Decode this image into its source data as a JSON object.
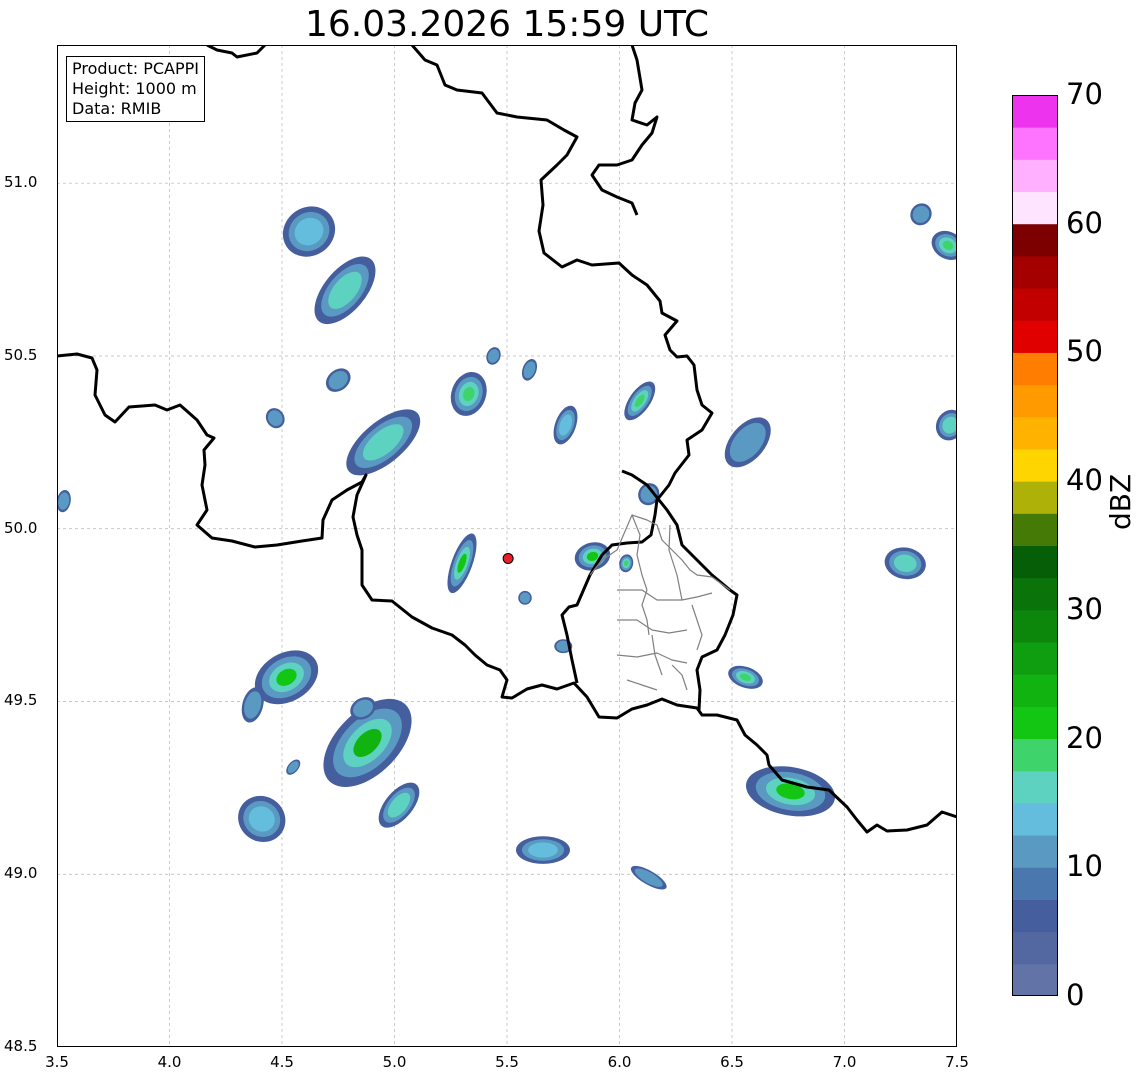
{
  "title": "16.03.2026 15:59 UTC",
  "info": {
    "product": "Product: PCAPPI",
    "height": "Height: 1000 m",
    "data": "Data: RMIB"
  },
  "map": {
    "lon_range": [
      3.5,
      7.5
    ],
    "lat_range": [
      48.5,
      51.4
    ],
    "grid": true,
    "x_ticks": [
      "3.5",
      "4.0",
      "4.5",
      "5.0",
      "5.5",
      "6.0",
      "6.5",
      "7.0",
      "7.5"
    ],
    "y_ticks": [
      "48.5",
      "49.0",
      "49.5",
      "50.0",
      "50.5",
      "51.0"
    ],
    "radar_site": {
      "lon": 5.505,
      "lat": 49.914,
      "color": "#e8202a"
    },
    "echoes": [
      {
        "lon": 4.62,
        "lat": 50.86,
        "rlon": 0.12,
        "rlat": 0.07,
        "angle": -35,
        "dbz": 14
      },
      {
        "lon": 4.78,
        "lat": 50.69,
        "rlon": 0.18,
        "rlat": 0.06,
        "angle": -50,
        "dbz": 16
      },
      {
        "lon": 4.95,
        "lat": 50.25,
        "rlon": 0.2,
        "rlat": 0.06,
        "angle": -40,
        "dbz": 16
      },
      {
        "lon": 4.75,
        "lat": 50.43,
        "rlon": 0.06,
        "rlat": 0.03,
        "angle": -40,
        "dbz": 10
      },
      {
        "lon": 4.47,
        "lat": 50.32,
        "rlon": 0.04,
        "rlat": 0.03,
        "angle": -30,
        "dbz": 10
      },
      {
        "lon": 5.33,
        "lat": 50.39,
        "rlon": 0.1,
        "rlat": 0.05,
        "angle": -70,
        "dbz": 18
      },
      {
        "lon": 5.44,
        "lat": 50.5,
        "rlon": 0.04,
        "rlat": 0.02,
        "angle": -70,
        "dbz": 10
      },
      {
        "lon": 5.6,
        "lat": 50.46,
        "rlon": 0.05,
        "rlat": 0.02,
        "angle": -70,
        "dbz": 10
      },
      {
        "lon": 5.76,
        "lat": 50.3,
        "rlon": 0.09,
        "rlat": 0.03,
        "angle": -70,
        "dbz": 14
      },
      {
        "lon": 6.09,
        "lat": 50.37,
        "rlon": 0.1,
        "rlat": 0.03,
        "angle": -55,
        "dbz": 18
      },
      {
        "lon": 6.13,
        "lat": 50.1,
        "rlon": 0.05,
        "rlat": 0.03,
        "angle": -60,
        "dbz": 10
      },
      {
        "lon": 6.57,
        "lat": 50.25,
        "rlon": 0.13,
        "rlat": 0.05,
        "angle": -50,
        "dbz": 12
      },
      {
        "lon": 5.3,
        "lat": 49.9,
        "rlon": 0.14,
        "rlat": 0.03,
        "angle": -70,
        "dbz": 20
      },
      {
        "lon": 5.88,
        "lat": 49.92,
        "rlon": 0.08,
        "rlat": 0.04,
        "angle": -15,
        "dbz": 20
      },
      {
        "lon": 6.03,
        "lat": 49.9,
        "rlon": 0.04,
        "rlat": 0.02,
        "angle": -80,
        "dbz": 18
      },
      {
        "lon": 5.58,
        "lat": 49.8,
        "rlon": 0.03,
        "rlat": 0.02,
        "angle": 0,
        "dbz": 10
      },
      {
        "lon": 5.75,
        "lat": 49.66,
        "rlon": 0.04,
        "rlat": 0.02,
        "angle": 0,
        "dbz": 10
      },
      {
        "lon": 4.52,
        "lat": 49.57,
        "rlon": 0.15,
        "rlat": 0.07,
        "angle": -30,
        "dbz": 22
      },
      {
        "lon": 4.37,
        "lat": 49.49,
        "rlon": 0.08,
        "rlat": 0.03,
        "angle": -75,
        "dbz": 12
      },
      {
        "lon": 4.88,
        "lat": 49.38,
        "rlon": 0.24,
        "rlat": 0.09,
        "angle": -45,
        "dbz": 24
      },
      {
        "lon": 5.02,
        "lat": 49.2,
        "rlon": 0.12,
        "rlat": 0.04,
        "angle": -50,
        "dbz": 16
      },
      {
        "lon": 4.41,
        "lat": 49.16,
        "rlon": 0.1,
        "rlat": 0.07,
        "angle": -55,
        "dbz": 14
      },
      {
        "lon": 4.55,
        "lat": 49.31,
        "rlon": 0.04,
        "rlat": 0.015,
        "angle": -50,
        "dbz": 10
      },
      {
        "lon": 5.66,
        "lat": 49.07,
        "rlon": 0.12,
        "rlat": 0.04,
        "angle": 0,
        "dbz": 14
      },
      {
        "lon": 6.13,
        "lat": 48.99,
        "rlon": 0.09,
        "rlat": 0.02,
        "angle": 30,
        "dbz": 12
      },
      {
        "lon": 6.76,
        "lat": 49.24,
        "rlon": 0.2,
        "rlat": 0.07,
        "angle": 10,
        "dbz": 22
      },
      {
        "lon": 6.56,
        "lat": 49.57,
        "rlon": 0.08,
        "rlat": 0.03,
        "angle": 20,
        "dbz": 18
      },
      {
        "lon": 7.27,
        "lat": 49.9,
        "rlon": 0.07,
        "rlat": 0.06,
        "angle": -80,
        "dbz": 16
      },
      {
        "lon": 7.34,
        "lat": 50.91,
        "rlon": 0.05,
        "rlat": 0.03,
        "angle": -55,
        "dbz": 10
      },
      {
        "lon": 7.46,
        "lat": 50.82,
        "rlon": 0.06,
        "rlat": 0.05,
        "angle": -60,
        "dbz": 18
      },
      {
        "lon": 7.47,
        "lat": 50.3,
        "rlon": 0.07,
        "rlat": 0.04,
        "angle": -60,
        "dbz": 16
      },
      {
        "lon": 3.53,
        "lat": 50.08,
        "rlon": 0.05,
        "rlat": 0.02,
        "angle": -80,
        "dbz": 10
      },
      {
        "lon": 4.86,
        "lat": 49.48,
        "rlon": 0.06,
        "rlat": 0.03,
        "angle": -30,
        "dbz": 12
      }
    ],
    "colors": {
      "border": "#000000",
      "subdivision": "#808080",
      "grid": "#b5b5b5"
    }
  },
  "colorbar": {
    "unit": "dBZ",
    "ticks": [
      "0",
      "10",
      "20",
      "30",
      "40",
      "50",
      "60",
      "70"
    ],
    "range": [
      0,
      70
    ],
    "bins": [
      "#6273a8",
      "#5367a0",
      "#445e9e",
      "#4a78ae",
      "#5a9ac2",
      "#64bddd",
      "#5ed2c0",
      "#3ed46b",
      "#13c613",
      "#10b310",
      "#0f9e0f",
      "#0c870c",
      "#0a740a",
      "#065f06",
      "#467a06",
      "#aeb208",
      "#ffd500",
      "#ffb300",
      "#ff9a00",
      "#ff7d00",
      "#e10000",
      "#c30000",
      "#a40000",
      "#7c0000",
      "#ffe4ff",
      "#ffb1ff",
      "#ff74ff",
      "#ee33ee"
    ]
  }
}
